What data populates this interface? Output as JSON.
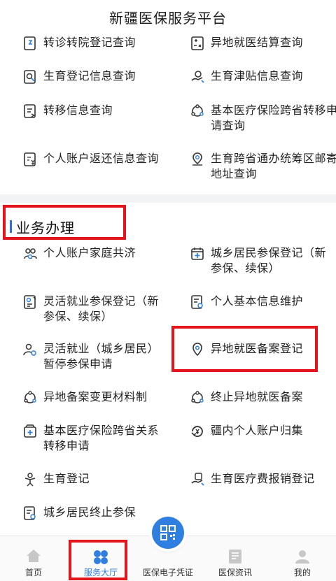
{
  "header": {
    "title": "新疆医保服务平台"
  },
  "query_items": [
    {
      "label": "转诊转院登记查询"
    },
    {
      "label": "异地就医结算查询"
    },
    {
      "label": "生育登记信息查询"
    },
    {
      "label": "生育津贴信息查询"
    },
    {
      "label": "转移信息查询"
    },
    {
      "label": "基本医疗保险跨省转移申请查询"
    },
    {
      "label": "个人账户返还信息查询"
    },
    {
      "label": "生育跨省通办统筹区邮寄地址查询"
    }
  ],
  "section": {
    "title": "业务办理"
  },
  "business_items": [
    {
      "label": "个人账户家庭共济"
    },
    {
      "label": "城乡居民参保登记（新参保、续保）"
    },
    {
      "label": "灵活就业参保登记（新参保、续保）"
    },
    {
      "label": "个人基本信息维护"
    },
    {
      "label": "灵活就业（城乡居民）暂停参保申请"
    },
    {
      "label": "异地就医备案登记"
    },
    {
      "label": "异地备案变更材料制"
    },
    {
      "label": "终止异地就医备案"
    },
    {
      "label": "基本医疗保险跨省关系转移申请"
    },
    {
      "label": "疆内个人账户归集"
    },
    {
      "label": "生育登记"
    },
    {
      "label": "生育医疗费报销登记"
    },
    {
      "label": "城乡居民终止参保"
    }
  ],
  "tabbar": {
    "tabs": [
      {
        "label": "首页",
        "icon": "home-icon"
      },
      {
        "label": "服务大厅",
        "icon": "clover-icon",
        "active": true
      },
      {
        "label": "医保电子凭证",
        "icon": "qr-code-icon"
      },
      {
        "label": "医保资讯",
        "icon": "news-icon"
      },
      {
        "label": "我的",
        "icon": "user-icon"
      }
    ]
  },
  "colors": {
    "accent": "#2f7fe0",
    "highlight": "#e3141c",
    "icon": "#333333"
  }
}
